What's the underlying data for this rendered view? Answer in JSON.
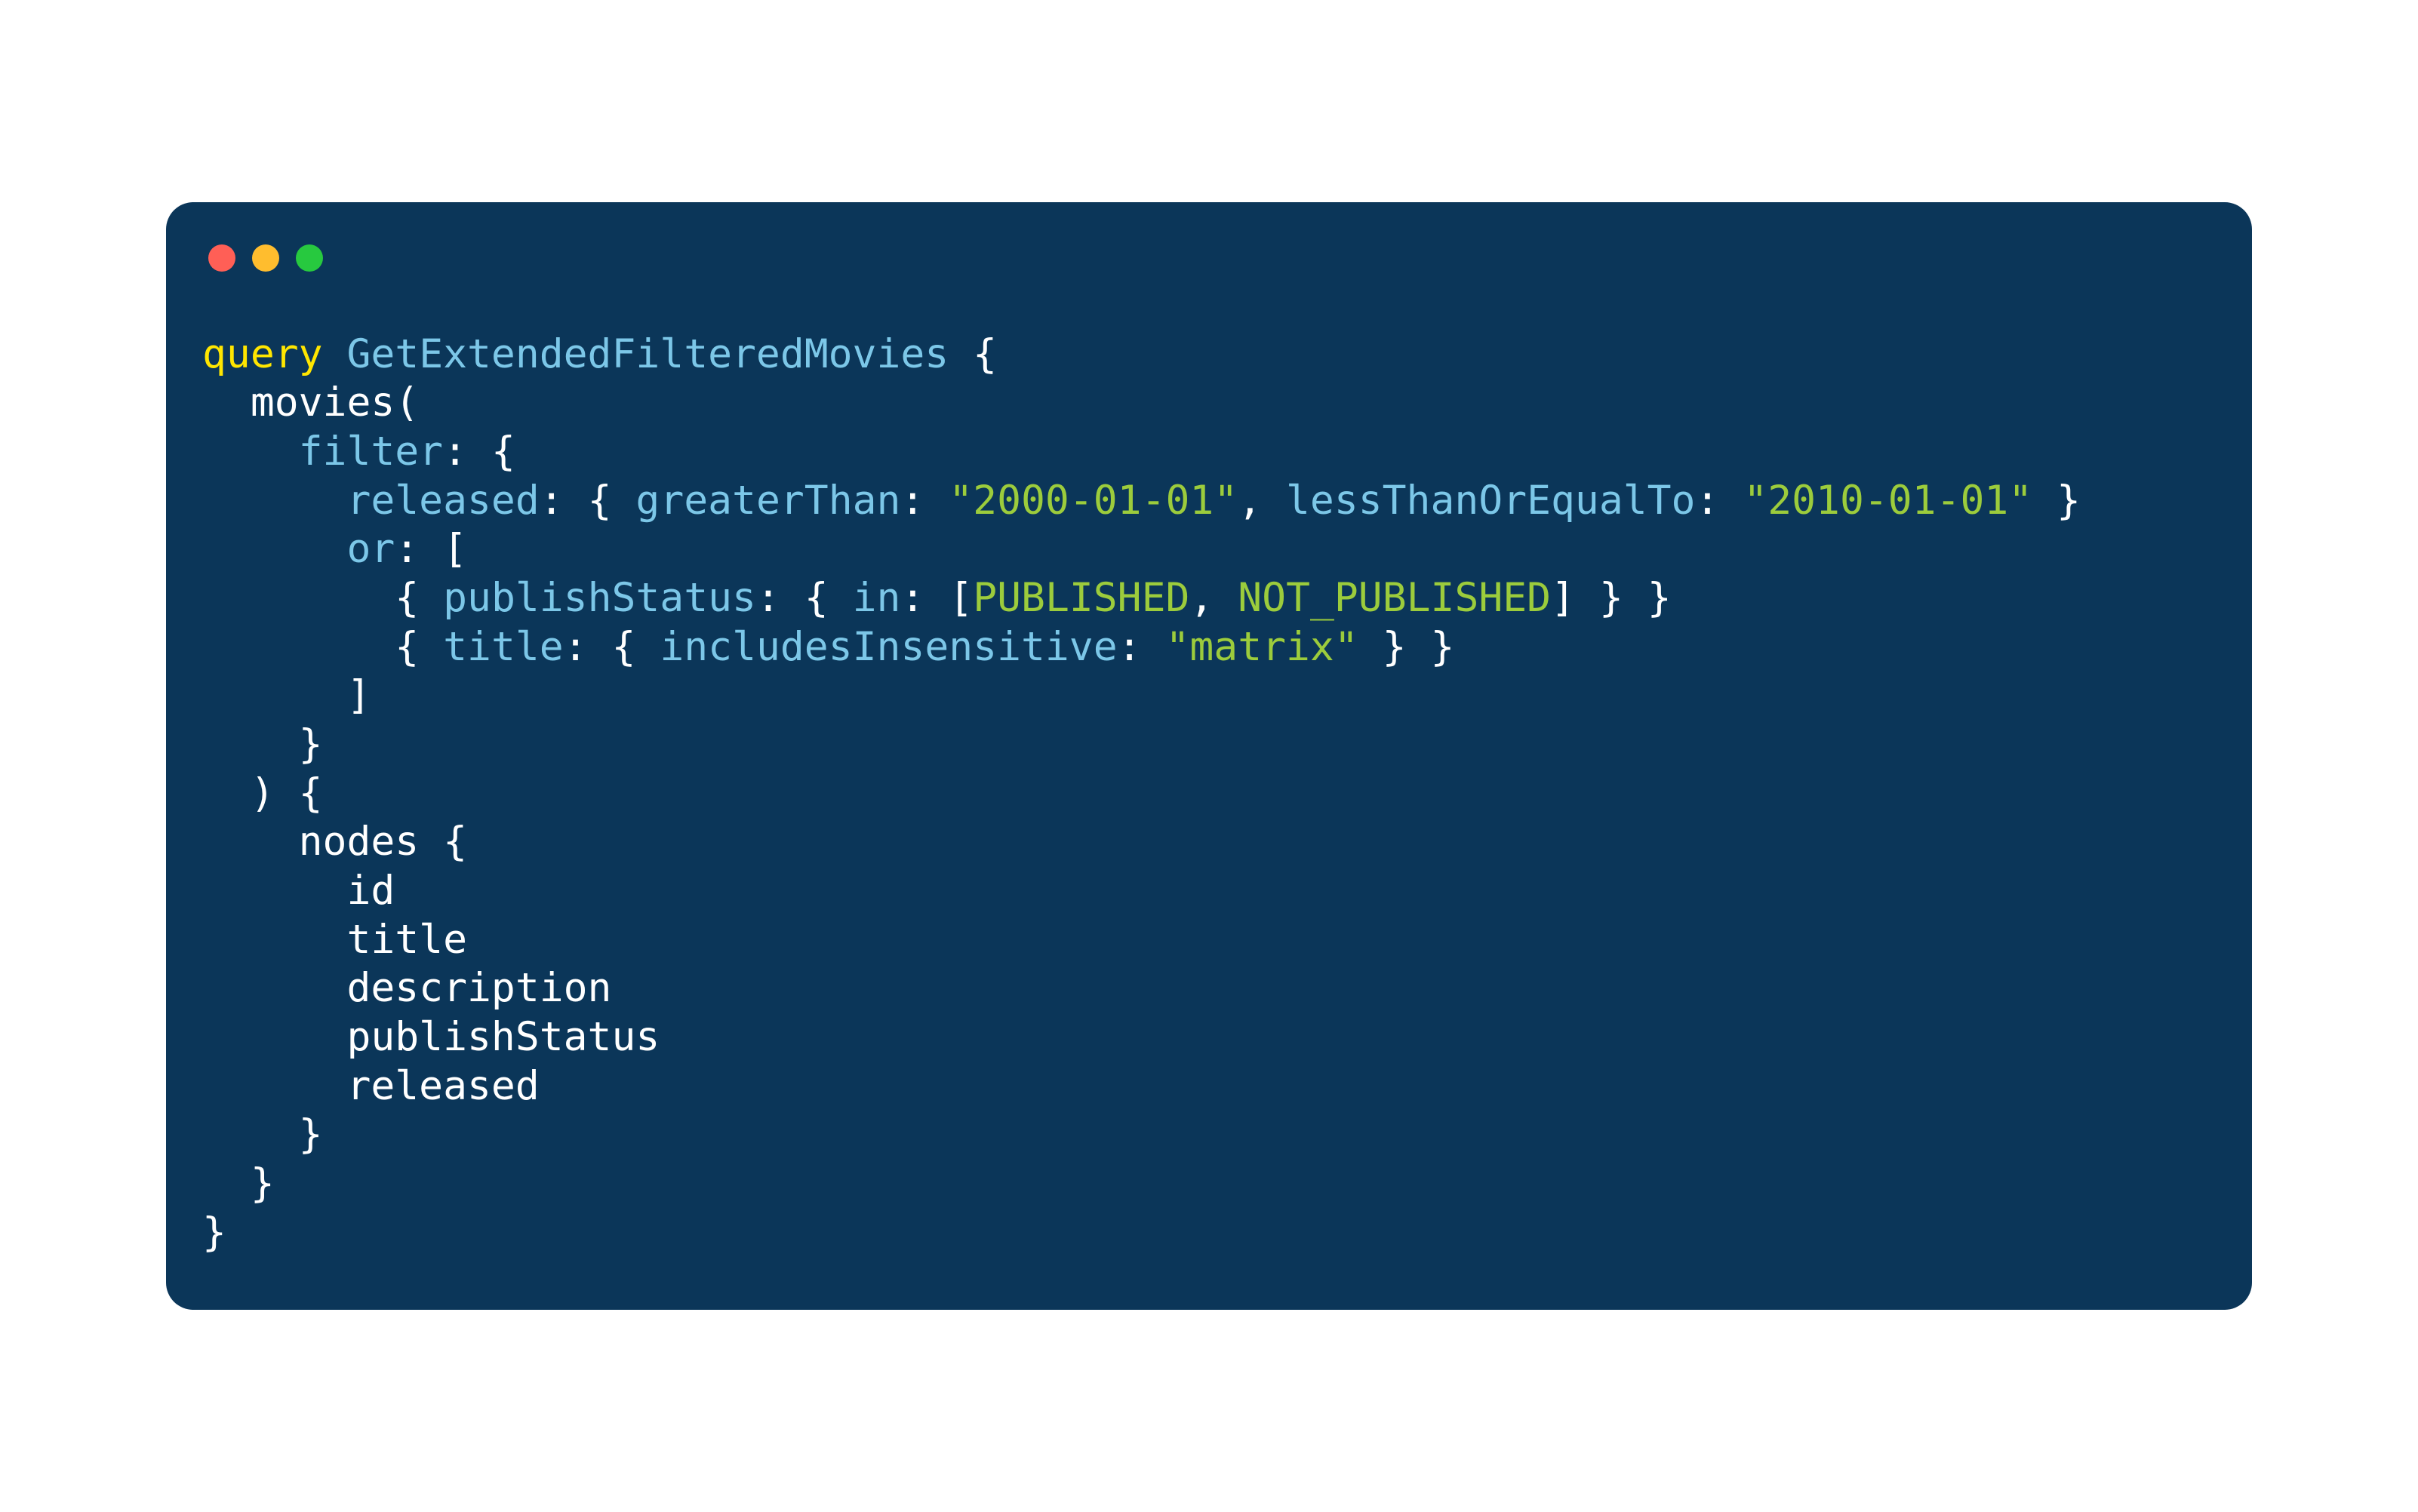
{
  "colors": {
    "background": "#0b3659",
    "keyword": "#ffe600",
    "field": "#7cc7e8",
    "string": "#9ccc3c",
    "enum": "#9ccc3c",
    "default": "#ffffff",
    "trafficRed": "#ff5f56",
    "trafficYellow": "#ffbd2e",
    "trafficGreen": "#27c93f"
  },
  "code": {
    "keyword_query": "query",
    "op_name": "GetExtendedFilteredMovies",
    "brace_open": "{",
    "brace_close": "}",
    "paren_open": "(",
    "paren_close": ")",
    "bracket_open": "[",
    "bracket_close": "]",
    "comma": ",",
    "colon": ":",
    "field_movies": "movies",
    "field_filter": "filter",
    "field_released": "released",
    "field_greaterThan": "greaterThan",
    "field_lessThanOrEqualTo": "lessThanOrEqualTo",
    "field_or": "or",
    "field_publishStatus": "publishStatus",
    "field_in": "in",
    "field_title": "title",
    "field_includesInsensitive": "includesInsensitive",
    "field_nodes": "nodes",
    "sel_id": "id",
    "sel_title": "title",
    "sel_description": "description",
    "sel_publishStatus": "publishStatus",
    "sel_released": "released",
    "str_date1": "\"2000-01-01\"",
    "str_date2": "\"2010-01-01\"",
    "str_matrix": "\"matrix\"",
    "enum_published": "PUBLISHED",
    "enum_not_published": "NOT_PUBLISHED"
  }
}
